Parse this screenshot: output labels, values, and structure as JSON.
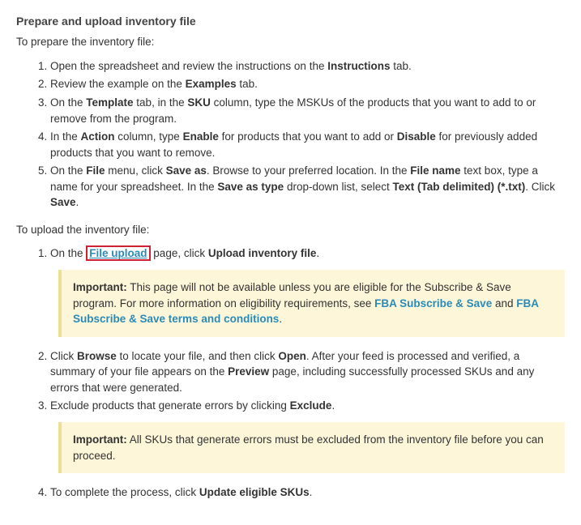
{
  "heading": "Prepare and upload inventory file",
  "prepare": {
    "intro": "To prepare the inventory file:",
    "step1_a": "Open the spreadsheet and review the instructions on the ",
    "step1_b": "Instructions",
    "step1_c": " tab.",
    "step2_a": "Review the example on the ",
    "step2_b": "Examples",
    "step2_c": " tab.",
    "step3_a": "On the ",
    "step3_b": "Template",
    "step3_c": " tab, in the ",
    "step3_d": "SKU",
    "step3_e": " column, type the MSKUs of the products that you want to add to or remove from the program.",
    "step4_a": "In the ",
    "step4_b": "Action",
    "step4_c": " column, type ",
    "step4_d": "Enable",
    "step4_e": " for products that you want to add or ",
    "step4_f": "Disable",
    "step4_g": " for previously added products that you want to remove.",
    "step5_a": "On the ",
    "step5_b": "File",
    "step5_c": " menu, click ",
    "step5_d": "Save as",
    "step5_e": ". Browse to your preferred location. In the ",
    "step5_f": "File name",
    "step5_g": " text box, type a name for your spreadsheet. In the ",
    "step5_h": "Save as type",
    "step5_i": " drop-down list, select ",
    "step5_j": "Text (Tab delimited) (*.txt)",
    "step5_k": ". Click ",
    "step5_l": "Save",
    "step5_m": "."
  },
  "upload": {
    "intro": "To upload the inventory file:",
    "step1_a": "On the ",
    "step1_b": "File upload",
    "step1_c": " page, click ",
    "step1_d": "Upload inventory file",
    "step1_e": ".",
    "note1_label": "Important:",
    "note1_a": " This page will not be available unless you are eligible for the Subscribe & Save program. For more information on eligibility requirements, see ",
    "note1_link1": "FBA Subscribe & Save",
    "note1_b": " and ",
    "note1_link2": "FBA Subscribe & Save terms and conditions",
    "note1_c": ".",
    "step2_a": "Click ",
    "step2_b": "Browse",
    "step2_c": " to locate your file, and then click ",
    "step2_d": "Open",
    "step2_e": ". After your feed is processed and verified, a summary of your file appears on the ",
    "step2_f": "Preview",
    "step2_g": " page, including successfully processed SKUs and any errors that were generated.",
    "step3_a": "Exclude products that generate errors by clicking ",
    "step3_b": "Exclude",
    "step3_c": ".",
    "note2_label": "Important:",
    "note2_a": " All SKUs that generate errors must be excluded from the inventory file before you can proceed.",
    "step4_a": "To complete the process, click ",
    "step4_b": "Update eligible SKUs",
    "step4_c": "."
  }
}
